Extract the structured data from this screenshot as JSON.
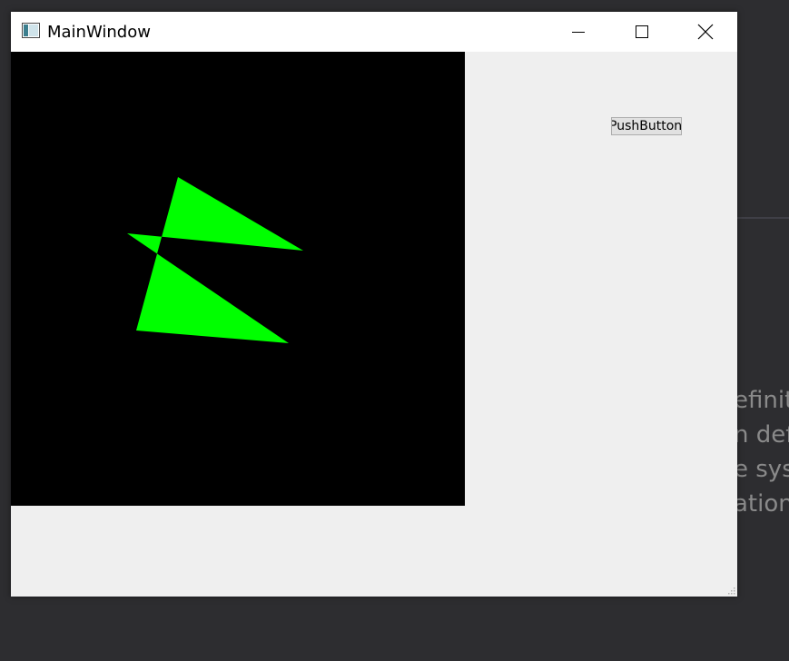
{
  "background": {
    "text_lines": [
      "efiniti",
      "n defi",
      "e sys",
      "ation"
    ]
  },
  "window": {
    "title": "MainWindow",
    "controls": {
      "minimize": "minimize-icon",
      "maximize": "maximize-icon",
      "close": "close-icon"
    }
  },
  "canvas": {
    "background_color": "#000000",
    "shape": "star",
    "shape_color": "#00ff00"
  },
  "push_button": {
    "label": "PushButton"
  },
  "colors": {
    "desktop": "#2d2d30",
    "window_client": "#efefef",
    "titlebar": "#ffffff"
  }
}
